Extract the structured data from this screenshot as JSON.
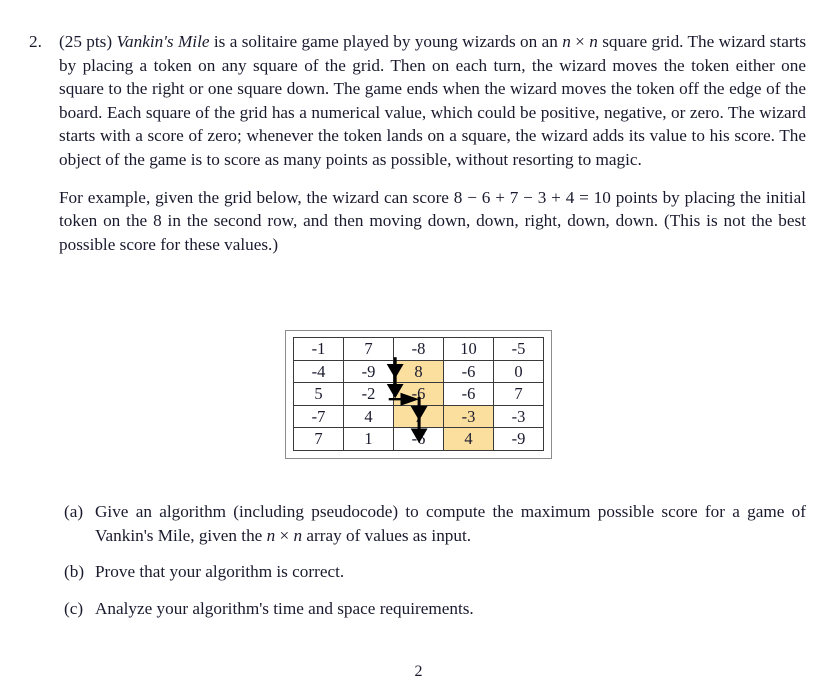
{
  "document": {
    "page_number": "2"
  },
  "problem": {
    "number": "2.",
    "points": "(25 pts)",
    "title": "Vankin's Mile",
    "paragraph1_a": " is a solitaire game played by young wizards on an ",
    "paragraph1_var1": "n",
    "paragraph1_times": "×",
    "paragraph1_var2": "n",
    "paragraph1_b": " square grid. The wizard starts by placing a token on any square of the grid. Then on each turn, the wizard moves the token either one square to the right or one square down. The game ends when the wizard moves the token off the edge of the board. Each square of the grid has a numerical value, which could be positive, negative, or zero. The wizard starts with a score of zero; whenever the token lands on a square, the wizard adds its value to his score. The object of the game is to score as many points as possible, without resorting to magic.",
    "paragraph2": "For example, given the grid below, the wizard can score 8 − 6 + 7 − 3 + 4 = 10 points by placing the initial token on the 8 in the second row, and then moving down, down, right, down, down. (This is not the best possible score for these values.)"
  },
  "grid": {
    "rows": [
      [
        "-1",
        "7",
        "-8",
        "10",
        "-5"
      ],
      [
        "-4",
        "-9",
        "8",
        "-6",
        "0"
      ],
      [
        "5",
        "-2",
        "-6",
        "-6",
        "7"
      ],
      [
        "-7",
        "4",
        "7",
        "-3",
        "-3"
      ],
      [
        "7",
        "1",
        "-6",
        "4",
        "-9"
      ]
    ],
    "highlighted_cells": [
      [
        1,
        2
      ],
      [
        2,
        2
      ],
      [
        3,
        2
      ],
      [
        3,
        3
      ],
      [
        4,
        3
      ]
    ],
    "highlight_color": "#fbdf9e",
    "border_color": "#3a3a3a",
    "frame_color": "#8c8c8c",
    "path_score_expression": "8 − 6 + 7 − 3 + 4 = 10",
    "path_moves": [
      "down",
      "down",
      "right",
      "down",
      "down"
    ],
    "arrow_color": "#000000"
  },
  "subparts": [
    {
      "label": "(a)",
      "text_a": "Give an algorithm (including pseudocode) to compute the maximum possible score for a game of Vankin's Mile, given the ",
      "var1": "n",
      "times": "×",
      "var2": "n",
      "text_b": " array of values as input."
    },
    {
      "label": "(b)",
      "text_a": "Prove that your algorithm is correct.",
      "var1": "",
      "times": "",
      "var2": "",
      "text_b": ""
    },
    {
      "label": "(c)",
      "text_a": "Analyze your algorithm's time and space requirements.",
      "var1": "",
      "times": "",
      "var2": "",
      "text_b": ""
    }
  ]
}
